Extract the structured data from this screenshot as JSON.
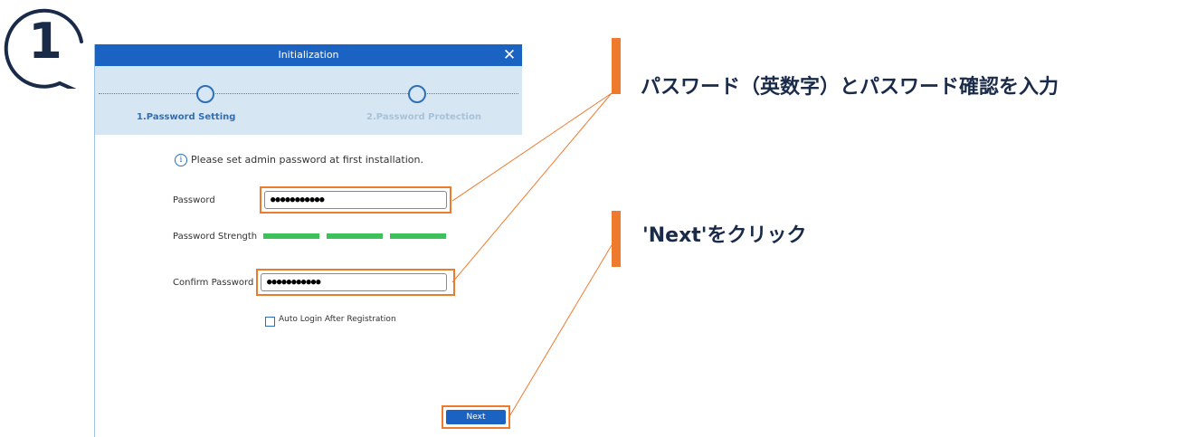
{
  "step_badge": "1",
  "dialog": {
    "title": "Initialization",
    "close_icon": "✕",
    "steps": [
      {
        "label": "1.Password Setting",
        "color": "#2f6fb8"
      },
      {
        "label": "2.Password Protection",
        "color": "#a8c2da"
      }
    ],
    "info_icon": "i",
    "info_text": "Please set admin password at first installation.",
    "password_label": "Password",
    "password_value": "●●●●●●●●●●●",
    "strength_label": "Password Strength",
    "strength_level": 3,
    "strength_color": "#3ec05a",
    "confirm_label": "Confirm Password",
    "confirm_value": "●●●●●●●●●●●",
    "auto_login_label": "Auto Login After Registration",
    "auto_login_checked": false,
    "next_label": "Next"
  },
  "callouts": [
    {
      "text": "パスワード（英数字）とパスワード確認を入力"
    },
    {
      "text": "'Next'をクリック"
    }
  ],
  "colors": {
    "accent": "#ee7a2e",
    "primary": "#1a63c2",
    "stepbar_bg": "#d6e6f2",
    "text_dark": "#1a2b4a"
  }
}
